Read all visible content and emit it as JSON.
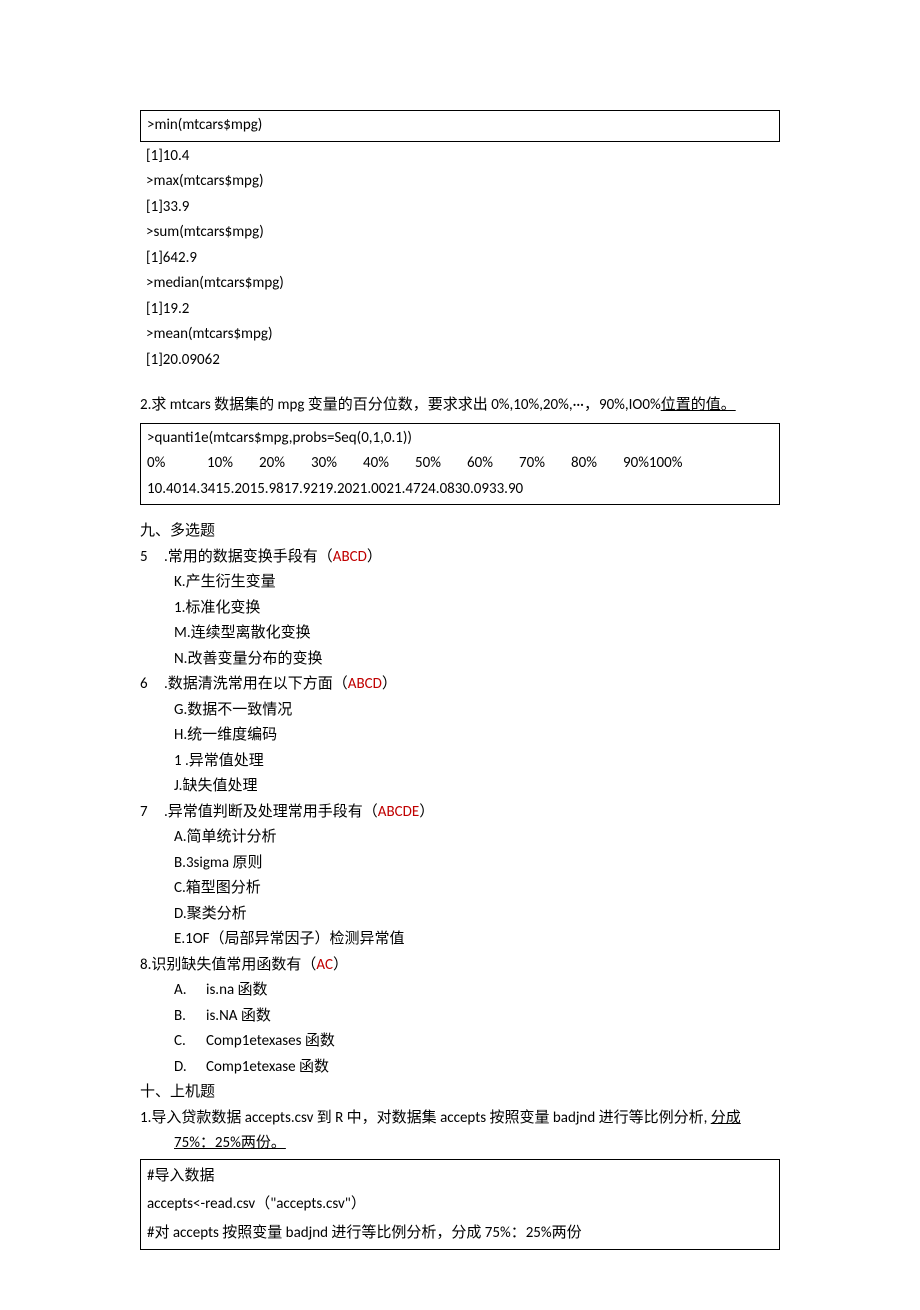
{
  "box1": {
    "line": ">min(mtcars$mpg)"
  },
  "block1": {
    "l1": "[1]10.4",
    "l2": ">max(mtcars$mpg)",
    "l3": "[1]33.9",
    "l4": ">sum(mtcars$mpg)",
    "l5": "[1]642.9",
    "l6": ">median(mtcars$mpg)",
    "l7": "[1]19.2",
    "l8": ">mean(mtcars$mpg)",
    "l9": "[1]20.09062"
  },
  "q2": {
    "pre": "2.求 mtcars 数据集的 mpg 变量的百分位数，要求求出 0%,10%,20%,···，90%,IO0%",
    "uline": "位置的值。"
  },
  "box2": {
    "l1": ">quanti1e(mtcars$mpg,probs=Seq(0,1,0.1))",
    "pcts": [
      "0%",
      "10%",
      "20%",
      "30%",
      "40%",
      "50%",
      "60%",
      "70%",
      "80%",
      "90%100%"
    ],
    "vals": "10.4014.3415.2015.9817.9219.2021.0021.4724.0830.0933.90"
  },
  "sec9": "九、多选题",
  "q5": {
    "num": "5",
    "text": ".常用的数据变换手段有（",
    "ans": "ABCD",
    "close": "）",
    "opts": {
      "a": "K.产生衍生变量",
      "b": "1.标准化变换",
      "c": "M.连续型离散化变换",
      "d": "N.改善变量分布的变换"
    }
  },
  "q6": {
    "num": "6",
    "text": ".数据清洗常用在以下方面（",
    "ans": "ABCD",
    "close": "）",
    "opts": {
      "a": "G.数据不一致情况",
      "b": "H.统一维度编码",
      "c": "1 .异常值处理",
      "d": "J.缺失值处理"
    }
  },
  "q7": {
    "num": "7",
    "text": ".异常值判断及处理常用手段有（",
    "ans": "ABCDE",
    "close": "）",
    "opts": {
      "a": "A.简单统计分析",
      "b": "B.3sigma 原则",
      "c": "C.箱型图分析",
      "d": "D.聚类分析",
      "e": "E.1OF（局部异常因子）检测异常值"
    }
  },
  "q8": {
    "num": "8.",
    "text": "识别缺失值常用函数有（",
    "ans": "AC",
    "close": "）",
    "opts": {
      "a": {
        "letter": "A.",
        "txt": "is.na 函数"
      },
      "b": {
        "letter": "B.",
        "txt": "is.NA 函数"
      },
      "c": {
        "letter": "C.",
        "txt": "Comp1etexases 函数"
      },
      "d": {
        "letter": "D.",
        "txt": "Comp1etexase 函数"
      }
    }
  },
  "sec10": "十、上机题",
  "q10_1": {
    "pre": "1.导入贷款数据 accepts.csv 到 R 中，对数据集 accepts 按照变量 badjnd 进行等比例分析, ",
    "u1": "分成",
    "u2": "75%：25%两份。"
  },
  "box3": {
    "l1": "#导入数据",
    "l2": "accepts<-read.csv（\"accepts.csv\"）",
    "l3": "#对 accepts 按照变量 badjnd 进行等比例分析，分成 75%：25%两份"
  }
}
